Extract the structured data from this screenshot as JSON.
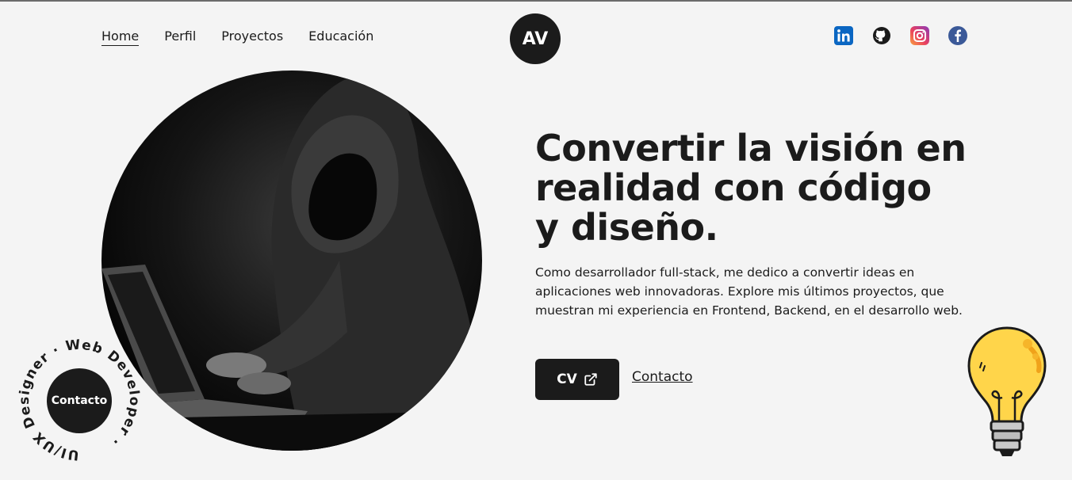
{
  "nav": {
    "items": [
      {
        "label": "Home",
        "active": true
      },
      {
        "label": "Perfil",
        "active": false
      },
      {
        "label": "Proyectos",
        "active": false
      },
      {
        "label": "Educación",
        "active": false
      }
    ]
  },
  "logo": {
    "text": "AV"
  },
  "socials": [
    "linkedin-icon",
    "github-icon",
    "instagram-icon",
    "facebook-icon"
  ],
  "hero": {
    "headline_line1": "Convertir la visión en",
    "headline_line2": "realidad con código",
    "headline_line3": "y diseño.",
    "paragraph": "Como desarrollador full-stack, me dedico a convertir ideas en aplicaciones web innovadoras. Explore mis últimos proyectos, que muestran mi experiencia en Frontend, Backend, en el desarrollo web.",
    "cv_label": "CV",
    "contact_label": "Contacto"
  },
  "badge": {
    "ring_text": "UI/UX Designer · Web Developer · ",
    "center_label": "Contacto"
  },
  "colors": {
    "background": "#f4f4f4",
    "dark": "#1b1b1b",
    "bulb_yellow": "#ffd54a"
  }
}
